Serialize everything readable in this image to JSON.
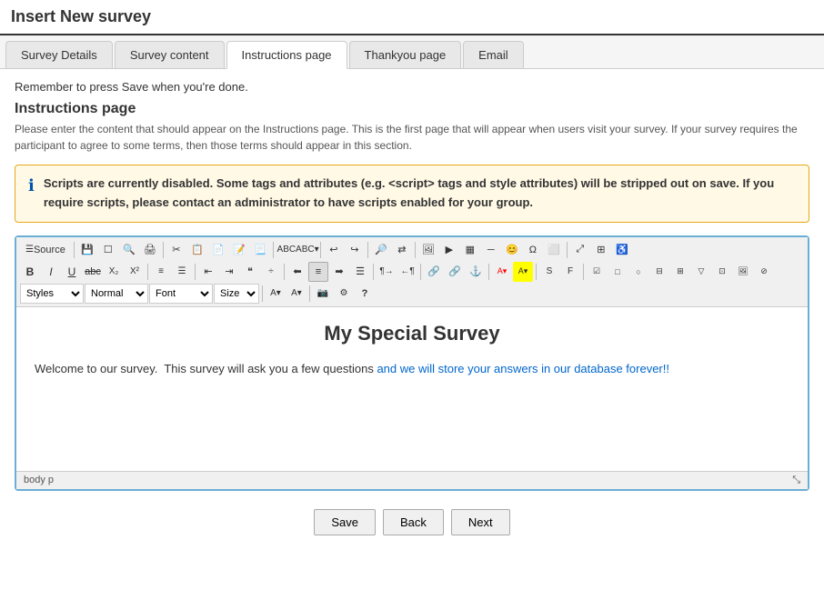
{
  "page": {
    "title": "Insert New survey"
  },
  "tabs": [
    {
      "id": "survey-details",
      "label": "Survey Details",
      "active": false
    },
    {
      "id": "survey-content",
      "label": "Survey content",
      "active": false
    },
    {
      "id": "instructions-page",
      "label": "Instructions page",
      "active": true
    },
    {
      "id": "thankyou-page",
      "label": "Thankyou page",
      "active": false
    },
    {
      "id": "email",
      "label": "Email",
      "active": false
    }
  ],
  "save_reminder": "Remember to press Save when you're done.",
  "section": {
    "title": "Instructions page",
    "description": "Please enter the content that should appear on the Instructions page. This is the first page that will appear when users visit your survey. If your survey requires the participant to agree to some terms, then those terms should appear in this section."
  },
  "warning": {
    "text_bold": "Scripts are currently disabled. Some tags and attributes (e.g. <script> tags and style attributes) will be stripped out on save. If you require scripts, please contact an administrator to have scripts enabled for your group."
  },
  "toolbar": {
    "row1": {
      "source_label": "Source",
      "buttons": [
        "save",
        "new-doc",
        "preview",
        "cut",
        "copy",
        "paste",
        "paste-text",
        "paste-word",
        "undo",
        "redo",
        "find",
        "spellcheck",
        "spellcheck-lang",
        "maximize",
        "show-blocks",
        "a11y",
        "print",
        "template",
        "image",
        "flash",
        "table",
        "horizontal-rule",
        "smiley",
        "special-char",
        "page-break",
        "iframe",
        "show-source"
      ]
    },
    "row2": {
      "bold": "B",
      "italic": "I",
      "underline": "U",
      "strikethrough": "abc",
      "subscript": "X₂",
      "superscript": "X²",
      "ol": "OL",
      "ul": "UL",
      "indent": "indent",
      "outdent": "outdent",
      "blockquote": "blockquote",
      "divcontainer": "div"
    },
    "row3": {
      "styles_placeholder": "Styles",
      "format_value": "Normal",
      "font_placeholder": "Font",
      "size_placeholder": "Size"
    }
  },
  "editor": {
    "title": "My Special Survey",
    "body": "Welcome to our survey.  This survey will ask you a few questions and we will store your answers in our database forever!!",
    "body_blue_start": "and we will store your answers in our database forever!!",
    "status_bar": "body  p"
  },
  "buttons": {
    "save": "Save",
    "back": "Back",
    "next": "Next"
  }
}
